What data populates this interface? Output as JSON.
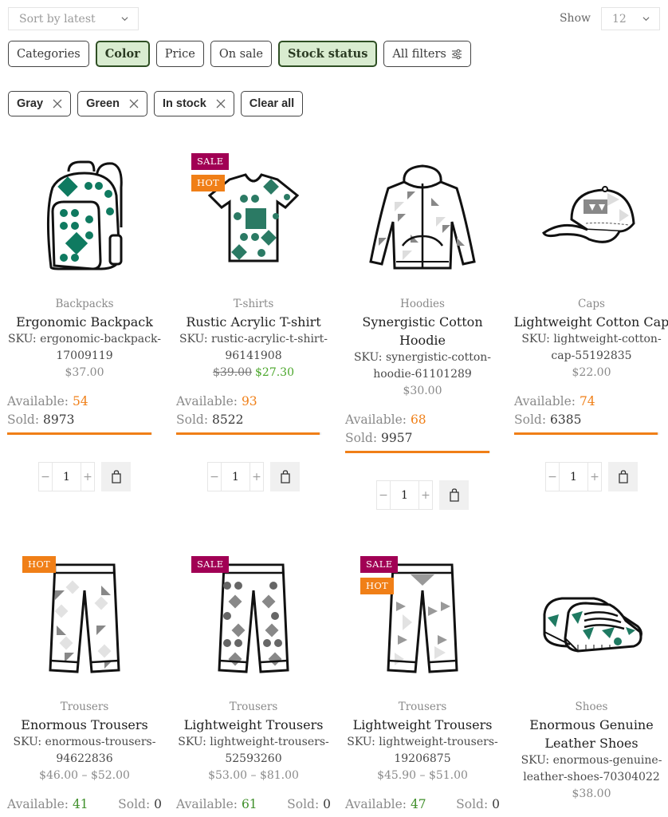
{
  "toolbar": {
    "sort_value": "Sort by latest",
    "show_label": "Show",
    "show_value": "12"
  },
  "filters": [
    {
      "label": "Categories",
      "active": false
    },
    {
      "label": "Color",
      "active": true
    },
    {
      "label": "Price",
      "active": false
    },
    {
      "label": "On sale",
      "active": false
    },
    {
      "label": "Stock status",
      "active": true
    },
    {
      "label": "All filters",
      "active": false,
      "icon": "sliders-icon"
    }
  ],
  "active_filters": [
    {
      "label": "Gray",
      "icon": "close-icon"
    },
    {
      "label": "Green",
      "icon": "close-icon"
    },
    {
      "label": "In stock",
      "icon": "close-icon"
    }
  ],
  "clear_all_label": "Clear all",
  "colors": {
    "accent_orange": "#f07f17",
    "sale_badge": "#a10054",
    "hot_badge": "#f07f17",
    "active_filter_bg": "#d9ecd0",
    "active_filter_border": "#2f4f24",
    "sale_price": "#4aa62a",
    "available_green": "#3f8f2a"
  },
  "products": [
    {
      "category": "Backpacks",
      "name": "Ergonomic Backpack",
      "sku": "SKU: ergonomic-backpack-17009119",
      "price": "$37.00",
      "old_price": null,
      "sale_price": null,
      "badges": [],
      "available_label": "Available:",
      "available": "54",
      "sold_label": "Sold:",
      "sold": "8973",
      "sold_fraction": 0.994,
      "quantity": "1",
      "image_icon": "backpack-image"
    },
    {
      "category": "T-shirts",
      "name": "Rustic Acrylic T-shirt",
      "sku": "SKU: rustic-acrylic-t-shirt-96141908",
      "price": null,
      "old_price": "$39.00",
      "sale_price": "$27.30",
      "badges": [
        "SALE",
        "HOT"
      ],
      "available_label": "Available:",
      "available": "93",
      "sold_label": "Sold:",
      "sold": "8522",
      "sold_fraction": 0.989,
      "quantity": "1",
      "image_icon": "tshirt-image"
    },
    {
      "category": "Hoodies",
      "name": "Synergistic Cotton Hoodie",
      "sku": "SKU: synergistic-cotton-hoodie-61101289",
      "price": "$30.00",
      "old_price": null,
      "sale_price": null,
      "badges": [],
      "available_label": "Available:",
      "available": "68",
      "sold_label": "Sold:",
      "sold": "9957",
      "sold_fraction": 0.993,
      "quantity": "1",
      "image_icon": "hoodie-image"
    },
    {
      "category": "Caps",
      "name": "Lightweight Cotton Cap",
      "sku": "SKU: lightweight-cotton-cap-55192835",
      "price": "$22.00",
      "old_price": null,
      "sale_price": null,
      "badges": [],
      "available_label": "Available:",
      "available": "74",
      "sold_label": "Sold:",
      "sold": "6385",
      "sold_fraction": 0.989,
      "quantity": "1",
      "image_icon": "cap-image"
    },
    {
      "category": "Trousers",
      "name": "Enormous Trousers",
      "sku": "SKU: enormous-trousers-94622836",
      "price": "$46.00 – $52.00",
      "badges": [
        "HOT"
      ],
      "available_label": "Available:",
      "available": "41",
      "sold_label": "Sold:",
      "sold": "0",
      "sold_fraction": 0,
      "image_icon": "trousers-image"
    },
    {
      "category": "Trousers",
      "name": "Lightweight Trousers",
      "sku": "SKU: lightweight-trousers-52593260",
      "price": "$53.00 – $81.00",
      "badges": [
        "SALE"
      ],
      "available_label": "Available:",
      "available": "61",
      "sold_label": "Sold:",
      "sold": "0",
      "sold_fraction": 0,
      "image_icon": "trousers-image"
    },
    {
      "category": "Trousers",
      "name": "Lightweight Trousers",
      "sku": "SKU: lightweight-trousers-19206875",
      "price": "$45.90 – $51.00",
      "badges": [
        "SALE",
        "HOT"
      ],
      "available_label": "Available:",
      "available": "47",
      "sold_label": "Sold:",
      "sold": "0",
      "sold_fraction": 0,
      "image_icon": "trousers-image"
    },
    {
      "category": "Shoes",
      "name": "Enormous Genuine Leather Shoes",
      "sku": "SKU: enormous-genuine-leather-shoes-70304022",
      "price": "$38.00",
      "badges": [],
      "image_icon": "shoes-image"
    }
  ]
}
